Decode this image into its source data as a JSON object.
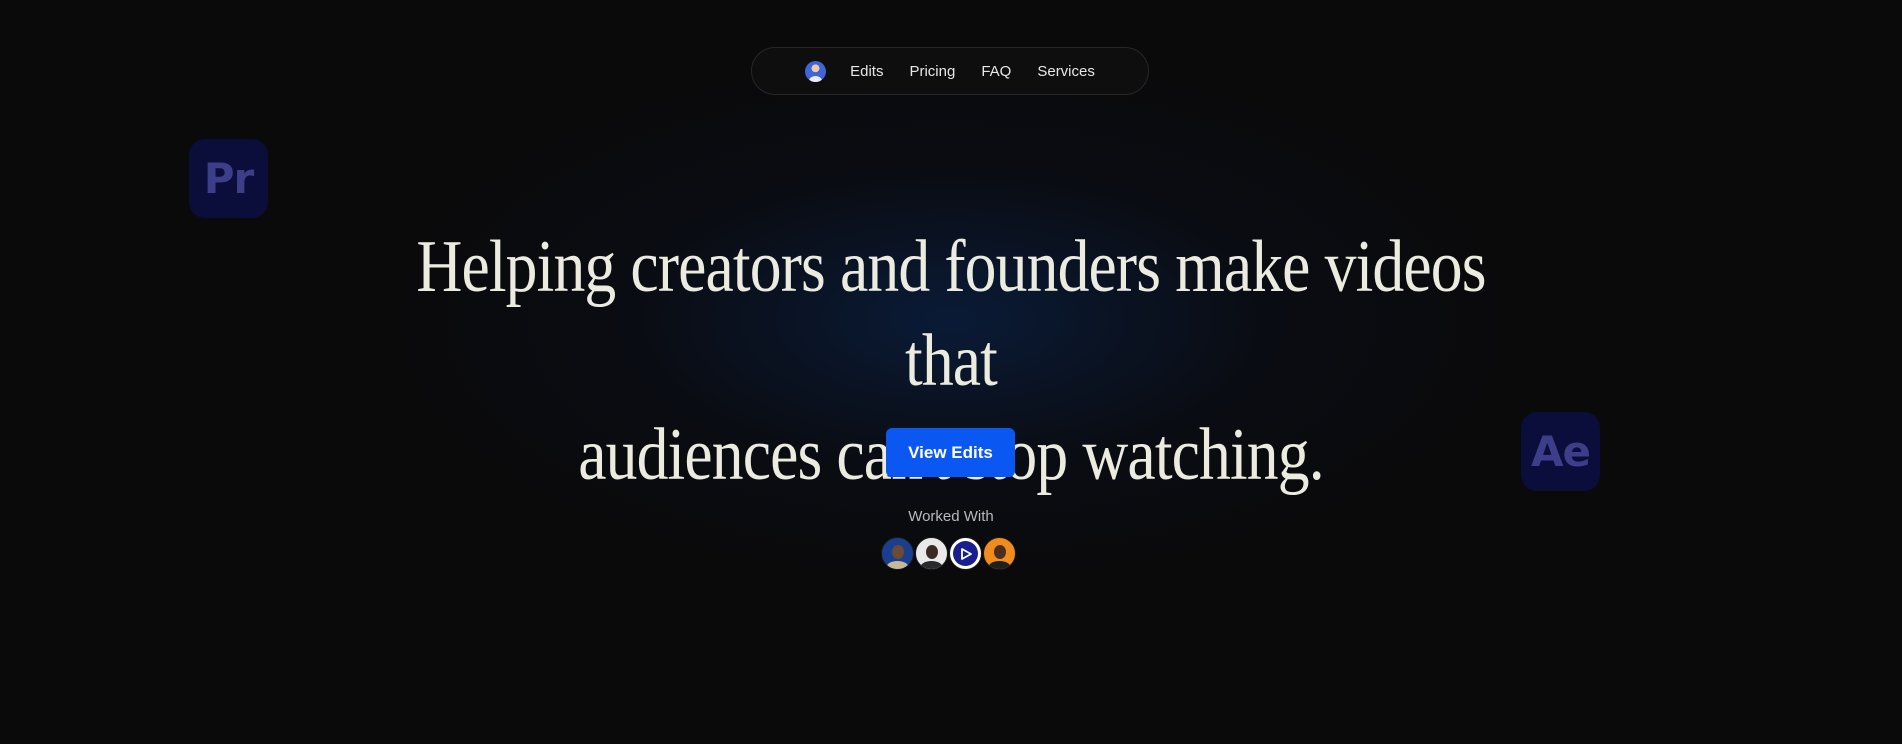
{
  "nav": {
    "avatar_icon": "profile-avatar-icon",
    "links": [
      "Edits",
      "Pricing",
      "FAQ",
      "Services"
    ]
  },
  "app_tiles": {
    "premiere": "Pr",
    "after_effects": "Ae"
  },
  "hero": {
    "headline_line1": "Helping creators and founders make videos that",
    "headline_line2": "audiences can't stop watching.",
    "cta_label": "View Edits",
    "worked_with_label": "Worked With"
  },
  "clients": [
    {
      "icon": "client-avatar-icon"
    },
    {
      "icon": "client-avatar-icon"
    },
    {
      "icon": "client-logo-play-icon"
    },
    {
      "icon": "client-avatar-icon"
    }
  ],
  "colors": {
    "background": "#0a0a0b",
    "accent": "#0b57f2",
    "headline": "#ecebe0",
    "tile_background": "#0b0d3a",
    "tile_text": "#3c3e8a"
  }
}
